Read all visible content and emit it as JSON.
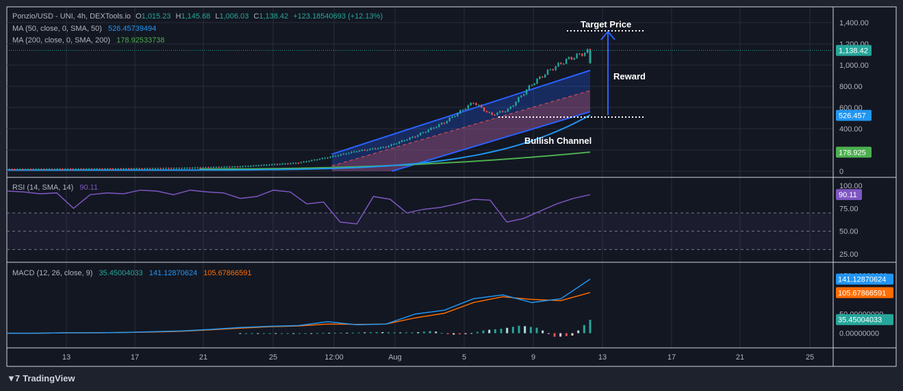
{
  "symbol": {
    "name": "Ponzio/USD - UNI, 4h, DEXTools.io",
    "o_label": "O",
    "o_value": "1,015.23",
    "h_label": "H",
    "h_value": "1,145.68",
    "l_label": "L",
    "l_value": "1,006.03",
    "c_label": "C",
    "c_value": "1,138.42",
    "change": "+123.18540693 (+12.13%)"
  },
  "indicators": {
    "ma50_label": "MA (50, close, 0, SMA, 50)",
    "ma50_value": "526.45739494",
    "ma200_label": "MA (200, close, 0, SMA, 200)",
    "ma200_value": "178.92533738",
    "rsi_label": "RSI (14, SMA, 14)",
    "rsi_value": "90.11",
    "macd_label": "MACD (12, 26, close, 9)",
    "macd_hist": "35.45004033",
    "macd_line": "141.12870624",
    "macd_signal": "105.67866591"
  },
  "price_axis": {
    "ticks": [
      "1,400.00",
      "1,200.00",
      "1,000.00",
      "800.00",
      "600.00",
      "400.00",
      "200.00",
      "0"
    ],
    "badges": {
      "close": "1,138.42",
      "ma50": "526.457",
      "ma200": "178.925"
    }
  },
  "rsi_axis": {
    "ticks": [
      "100.00",
      "75.00",
      "50.00",
      "25.00"
    ],
    "badge": "90.11"
  },
  "macd_axis": {
    "ticks": [
      "150.00000000",
      "50.00000000",
      "0.00000000"
    ],
    "badges": {
      "macd": "141.12870624",
      "signal": "105.67866591",
      "hist": "35.45004033"
    }
  },
  "time_axis": {
    "labels": [
      "13",
      "17",
      "21",
      "25",
      "12:00",
      "Aug",
      "5",
      "9",
      "13",
      "17",
      "21",
      "25"
    ]
  },
  "annotations": {
    "target": "Target Price",
    "reward": "Reward",
    "channel": "Bullish Channel"
  },
  "brand": {
    "name": "TradingView"
  },
  "colors": {
    "bg": "#1e222d",
    "up": "#26a69a",
    "down": "#ef5350",
    "ma50": "#2196f3",
    "ma200": "#4caf50",
    "rsi": "#7e57c2",
    "macd": "#2196f3",
    "signal": "#ff6d00",
    "channel": "#2962ff",
    "grid": "#2a2e39"
  },
  "chart_data": [
    {
      "type": "candlestick",
      "title": "Ponzio/USD - UNI, 4h, DEXTools.io",
      "ylim": [
        0,
        1400
      ],
      "x_labels": [
        "13",
        "17",
        "21",
        "25",
        "12:00",
        "Aug",
        "5",
        "9",
        "13"
      ],
      "close_path": [
        [
          0,
          20
        ],
        [
          0.1,
          22
        ],
        [
          0.2,
          25
        ],
        [
          0.3,
          30
        ],
        [
          0.4,
          45
        ],
        [
          0.5,
          80
        ],
        [
          0.55,
          130
        ],
        [
          0.6,
          190
        ],
        [
          0.65,
          230
        ],
        [
          0.7,
          330
        ],
        [
          0.75,
          460
        ],
        [
          0.8,
          650
        ],
        [
          0.83,
          530
        ],
        [
          0.86,
          580
        ],
        [
          0.9,
          820
        ],
        [
          0.93,
          950
        ],
        [
          0.96,
          1050
        ],
        [
          1,
          1138
        ]
      ],
      "series": [
        {
          "name": "MA (50, close, 0, SMA, 50)",
          "last": 526.457
        },
        {
          "name": "MA (200, close, 0, SMA, 200)",
          "last": 178.925
        }
      ]
    },
    {
      "type": "line",
      "title": "RSI (14, SMA, 14)",
      "ylim": [
        25,
        100
      ],
      "values": [
        94,
        93,
        91,
        92,
        75,
        90,
        92,
        91,
        95,
        94,
        90,
        95,
        93,
        92,
        86,
        88,
        95,
        93,
        80,
        82,
        60,
        58,
        88,
        85,
        70,
        74,
        76,
        80,
        85,
        84,
        60,
        64,
        72,
        80,
        86,
        90
      ]
    },
    {
      "type": "line",
      "title": "MACD (12, 26, close, 9)",
      "series": [
        {
          "name": "MACD",
          "values": [
            0,
            0,
            1,
            1,
            2,
            4,
            6,
            10,
            15,
            18,
            20,
            30,
            22,
            24,
            50,
            60,
            90,
            100,
            80,
            90,
            141
          ]
        },
        {
          "name": "Signal",
          "values": [
            0,
            0,
            1,
            1,
            2,
            3,
            5,
            9,
            13,
            17,
            19,
            24,
            23,
            24,
            40,
            52,
            80,
            95,
            88,
            85,
            106
          ]
        }
      ],
      "histogram": [
        0,
        0,
        0,
        0,
        0,
        1,
        1,
        2,
        3,
        2,
        2,
        6,
        -4,
        -2,
        8,
        12,
        20,
        14,
        -10,
        -6,
        35
      ]
    }
  ]
}
